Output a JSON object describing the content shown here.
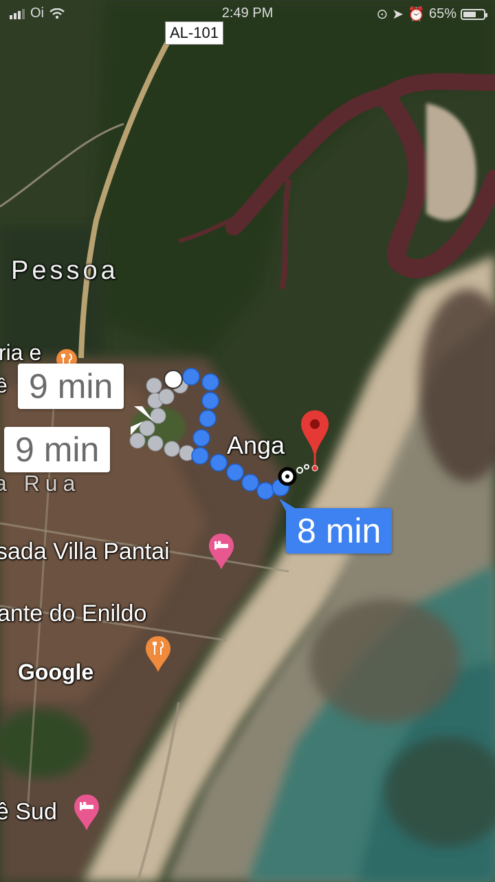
{
  "status_bar": {
    "carrier": "Oi",
    "time": "2:49 PM",
    "battery": "65%",
    "battery_level": 0.65
  },
  "road_shield": "AL-101",
  "labels": {
    "area_pessoa": "Pessoa",
    "area_rua": "a Rua",
    "anga": "Anga",
    "villa_pantai": "sada Villa Pantai",
    "enildo": "ante do Enildo",
    "google": "Google",
    "sud": "ê Sud",
    "cut_top": "ria e",
    "cut_bottom": "ê"
  },
  "routes": [
    {
      "time": "9 min",
      "selected": false
    },
    {
      "time": "9 min",
      "selected": false
    },
    {
      "time": "8 min",
      "selected": true
    }
  ],
  "colors": {
    "route_selected": "#3d82f0",
    "route_alt": "#b9bcc2",
    "destination_pin": "#e53935",
    "lodging_pin": "#e8578f",
    "restaurant_pin": "#f08a3c"
  },
  "icons": {
    "restaurant": "fork-knife-icon",
    "lodging": "bed-icon",
    "destination": "map-pin-icon",
    "origin": "location-dot-icon"
  }
}
